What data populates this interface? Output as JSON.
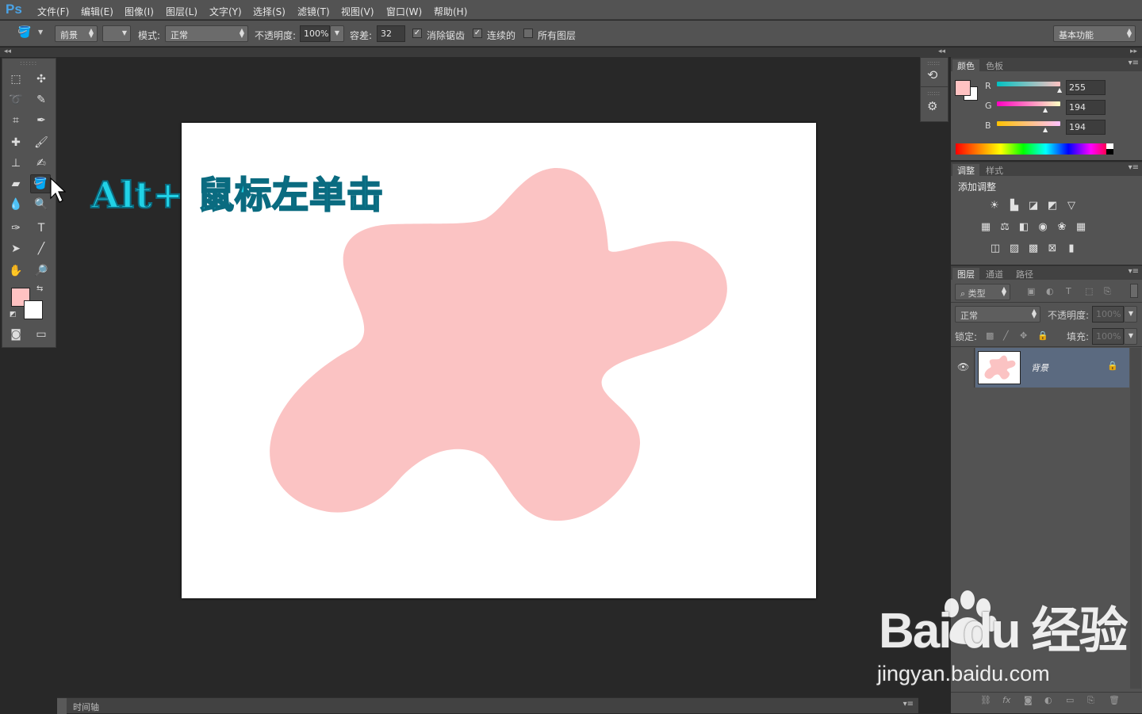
{
  "app": {
    "logo": "Ps"
  },
  "menu": [
    "文件(F)",
    "编辑(E)",
    "图像(I)",
    "图层(L)",
    "文字(Y)",
    "选择(S)",
    "滤镜(T)",
    "视图(V)",
    "窗口(W)",
    "帮助(H)"
  ],
  "options": {
    "fill_source": "前景",
    "mode_label": "模式:",
    "mode_value": "正常",
    "opacity_label": "不透明度:",
    "opacity_value": "100%",
    "tolerance_label": "容差:",
    "tolerance_value": "32",
    "antialias_label": "消除锯齿",
    "antialias_checked": true,
    "contiguous_label": "连续的",
    "contiguous_checked": true,
    "all_layers_label": "所有图层",
    "all_layers_checked": false,
    "workspace": "基本功能"
  },
  "colors": {
    "foreground": "#ffc2c2",
    "background": "#ffffff",
    "shape_fill": "#fbc3c3",
    "overlay_text": "#21d2e6"
  },
  "overlay": {
    "text": "Alt+ 鼠标左单击"
  },
  "color_panel": {
    "tabs": [
      "颜色",
      "色板"
    ],
    "channels": [
      {
        "label": "R",
        "value": "255"
      },
      {
        "label": "G",
        "value": "194"
      },
      {
        "label": "B",
        "value": "194"
      }
    ]
  },
  "adjust_panel": {
    "tabs": [
      "调整",
      "样式"
    ],
    "title": "添加调整"
  },
  "layers_panel": {
    "tabs": [
      "图层",
      "通道",
      "路径"
    ],
    "filter_label": "类型",
    "blend_mode": "正常",
    "opacity_label": "不透明度:",
    "opacity_value": "100%",
    "lock_label": "锁定:",
    "fill_label": "填充:",
    "fill_value": "100%",
    "layers": [
      {
        "name": "背景"
      }
    ]
  },
  "timeline": {
    "label": "时间轴"
  },
  "watermark": {
    "brand": "Bai du 经验",
    "url": "jingyan.baidu.com"
  }
}
